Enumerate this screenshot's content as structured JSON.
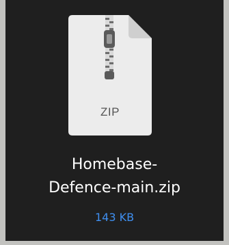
{
  "file": {
    "type_label": "ZIP",
    "name_line1": "Homebase-",
    "name_line2": "Defence-main.zip",
    "size": "143 KB",
    "icon": "zip-archive-icon"
  },
  "colors": {
    "background": "#1f1f1f",
    "border": "#c2c2bf",
    "text": "#ffffff",
    "size_text": "#3f8ff0",
    "icon_body": "#ececec"
  }
}
